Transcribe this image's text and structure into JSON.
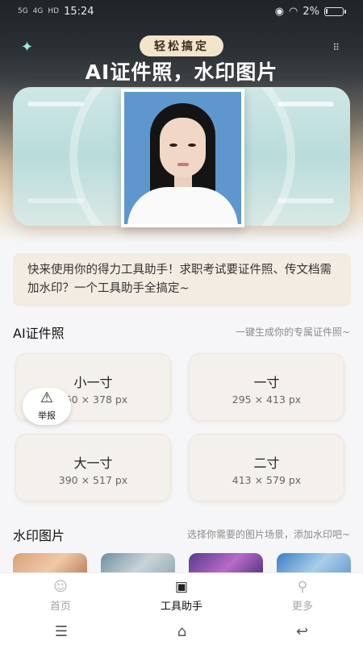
{
  "status_bar": {
    "network_left": "5G",
    "network_mid": "4G",
    "hd": "HD",
    "time": "15:24",
    "battery": "2%",
    "battery_level": 0.02
  },
  "hero": {
    "badge": "轻松搞定",
    "title": "AI证件照，水印图片",
    "sparkle_icon": "sparkle-icon",
    "menu_icon": "more-dots-icon"
  },
  "intro": {
    "text": "快来使用你的得力工具助手！求职考试要证件照、传文档需加水印？一个工具助手全搞定~"
  },
  "id_photo_section": {
    "title": "AI证件照",
    "subtitle": "一键生成你的专属证件照~",
    "sizes": [
      {
        "name": "小一寸",
        "dim": "260 × 378 px"
      },
      {
        "name": "一寸",
        "dim": "295 × 413 px"
      },
      {
        "name": "大一寸",
        "dim": "390 × 517 px"
      },
      {
        "name": "二寸",
        "dim": "413 × 579 px"
      }
    ]
  },
  "report": {
    "label": "举报",
    "icon": "warning-icon"
  },
  "watermark_section": {
    "title": "水印图片",
    "subtitle": "选择你需要的图片场景，添加水印吧~"
  },
  "bottom_nav": [
    {
      "label": "首页",
      "icon": "home-icon",
      "active": false
    },
    {
      "label": "工具助手",
      "icon": "toolbox-icon",
      "active": true
    },
    {
      "label": "更多",
      "icon": "user-icon",
      "active": false
    }
  ],
  "system_nav": {
    "menu": "menu-icon",
    "home": "home-outline-icon",
    "back": "back-icon"
  },
  "colors": {
    "badge_bg": "#f3e4cc",
    "card_bg": "#f4f1ec",
    "intro_bg": "#f3ece2",
    "photo_bg": "#5e97cd"
  }
}
